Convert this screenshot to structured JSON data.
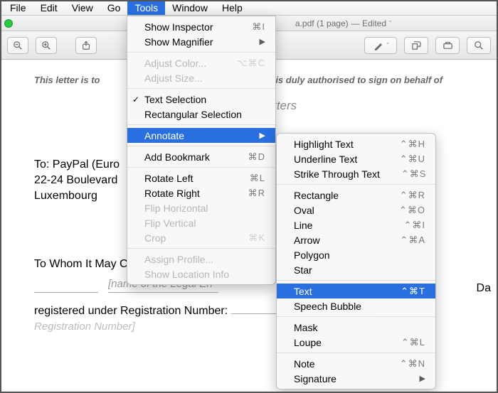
{
  "menubar": {
    "items": [
      "File",
      "Edit",
      "View",
      "Go",
      "Tools",
      "Window",
      "Help"
    ],
    "active_index": 4
  },
  "window": {
    "title_suffix": "a.pdf (1 page)",
    "edited": "— Edited"
  },
  "tools_menu": {
    "show_inspector": {
      "label": "Show Inspector",
      "sc": "⌘I"
    },
    "show_magnifier": {
      "label": "Show Magnifier"
    },
    "adjust_color": {
      "label": "Adjust Color...",
      "sc": "⌥⌘C"
    },
    "adjust_size": {
      "label": "Adjust Size..."
    },
    "text_selection": {
      "label": "Text Selection",
      "checked": true
    },
    "rect_selection": {
      "label": "Rectangular Selection"
    },
    "annotate": {
      "label": "Annotate"
    },
    "add_bookmark": {
      "label": "Add Bookmark",
      "sc": "⌘D"
    },
    "rotate_left": {
      "label": "Rotate Left",
      "sc": "⌘L"
    },
    "rotate_right": {
      "label": "Rotate Right",
      "sc": "⌘R"
    },
    "flip_h": {
      "label": "Flip Horizontal"
    },
    "flip_v": {
      "label": "Flip Vertical"
    },
    "crop": {
      "label": "Crop",
      "sc": "⌘K"
    },
    "assign_profile": {
      "label": "Assign Profile..."
    },
    "show_location": {
      "label": "Show Location Info"
    }
  },
  "annotate_menu": {
    "highlight": {
      "label": "Highlight Text",
      "sc": "⌃⌘H"
    },
    "underline": {
      "label": "Underline Text",
      "sc": "⌃⌘U"
    },
    "strike": {
      "label": "Strike Through Text",
      "sc": "⌃⌘S"
    },
    "rectangle": {
      "label": "Rectangle",
      "sc": "⌃⌘R"
    },
    "oval": {
      "label": "Oval",
      "sc": "⌃⌘O"
    },
    "line": {
      "label": "Line",
      "sc": "⌃⌘I"
    },
    "arrow": {
      "label": "Arrow",
      "sc": "⌃⌘A"
    },
    "polygon": {
      "label": "Polygon"
    },
    "star": {
      "label": "Star"
    },
    "text": {
      "label": "Text",
      "sc": "⌃⌘T"
    },
    "speech": {
      "label": "Speech Bubble"
    },
    "mask": {
      "label": "Mask"
    },
    "loupe": {
      "label": "Loupe",
      "sc": "⌃⌘L"
    },
    "note": {
      "label": "Note",
      "sc": "⌃⌘N"
    },
    "signature": {
      "label": "Signature"
    }
  },
  "doc": {
    "lead_prefix": "This letter is to",
    "lead_suffix": "who is duly authorised to sign on behalf of",
    "sub": "nplete in capital letters",
    "addr_line1": "To: PayPal (Euro",
    "addr_line2": "22-24 Boulevard",
    "addr_line3": "Luxembourg",
    "date": "Da",
    "greeting": "To Whom It May Concern,",
    "legal_fill": "[name of the Legal En",
    "regnum": "registered under Registration Number:",
    "regnum_fill": "Registration Number]"
  }
}
